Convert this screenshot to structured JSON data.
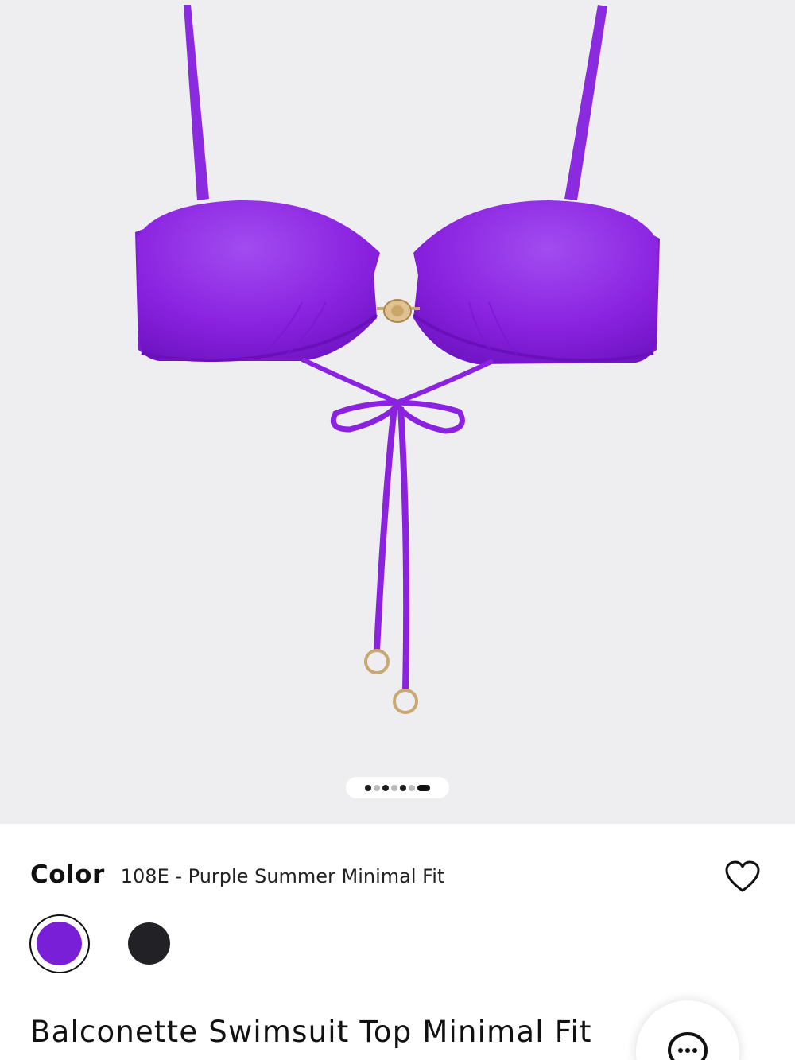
{
  "gallery": {
    "image_alt": "Purple balconette bikini top",
    "pager": {
      "total": 7,
      "current": 7
    }
  },
  "product": {
    "color_label": "Color",
    "color_value": "108E - Purple Summer Minimal Fit",
    "title": "Balconette Swimsuit Top Minimal Fit"
  },
  "swatches": [
    {
      "color": "#7a1fd8",
      "selected": true
    },
    {
      "color": "#222226",
      "selected": false
    }
  ],
  "icons": {
    "favorite": "heart-icon",
    "chat": "chat-bubble-icon"
  },
  "colors": {
    "gallery_background": "#eeeef0",
    "product_purple": "#8a22e0",
    "text": "#111111"
  }
}
